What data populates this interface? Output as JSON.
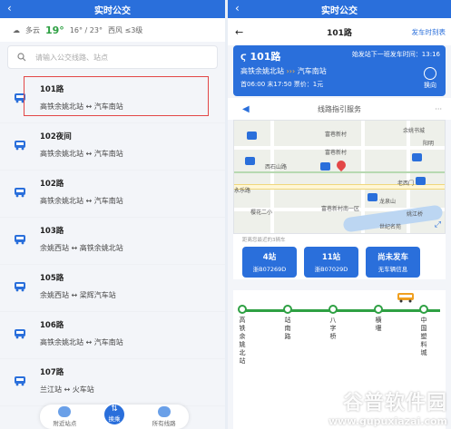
{
  "left": {
    "title": "实时公交",
    "weather": {
      "condition": "多云",
      "temp": "19°",
      "range": "16° / 23°",
      "wind": "西风 ≤3级"
    },
    "search_placeholder": "请输入公交线路、站点",
    "lines": [
      {
        "name": "101路",
        "route": "高铁余姚北站 ↔ 汽车南站"
      },
      {
        "name": "102夜间",
        "route": "高铁余姚北站 ↔ 汽车南站"
      },
      {
        "name": "102路",
        "route": "高铁余姚北站 ↔ 汽车南站"
      },
      {
        "name": "103路",
        "route": "余姚西站 ↔ 高铁余姚北站"
      },
      {
        "name": "105路",
        "route": "余姚西站 ↔ 梁辉汽车站"
      },
      {
        "name": "106路",
        "route": "高铁余姚北站 ↔ 汽车南站"
      },
      {
        "name": "107路",
        "route": "兰江站 ↔ 火车站"
      }
    ],
    "nav": {
      "nearby": "附近站点",
      "transfer": "换乘",
      "all_lines": "所有线路"
    }
  },
  "right": {
    "title": "实时公交",
    "header": "101路",
    "timetable": "发车时刻表",
    "card": {
      "line": "101路",
      "next_label": "始发站下一班发车时间：13:16",
      "from": "高铁余姚北站",
      "to": "汽车南站",
      "times": "首06:00  末17:50  票价：1元",
      "swap": "换向"
    },
    "service": "线路指引服务",
    "map_labels": [
      "富巷新村",
      "西石山路",
      "富巷新村",
      "余姚书城",
      "阳明",
      "永乐路",
      "老西门",
      "姚江桥",
      "世纪名苑",
      "樱花二小",
      "富巷新村南一区",
      "龙泉山"
    ],
    "note": "距离您最近的3辆车",
    "buses": [
      {
        "stops": "4站",
        "plate": "浙B07269D"
      },
      {
        "stops": "11站",
        "plate": "浙B07029D"
      },
      {
        "stops": "尚未发车",
        "plate": "无车辆信息"
      }
    ],
    "stations": [
      "高铁余姚北站",
      "站南路",
      "八字桥",
      "横堰",
      "中国塑料城"
    ]
  },
  "watermark": {
    "brand": "谷普软件园",
    "url": "www.gupuxiazai.com"
  },
  "colors": {
    "primary": "#2a6fdb",
    "accent": "#2ea043",
    "highlight": "#e34747"
  }
}
